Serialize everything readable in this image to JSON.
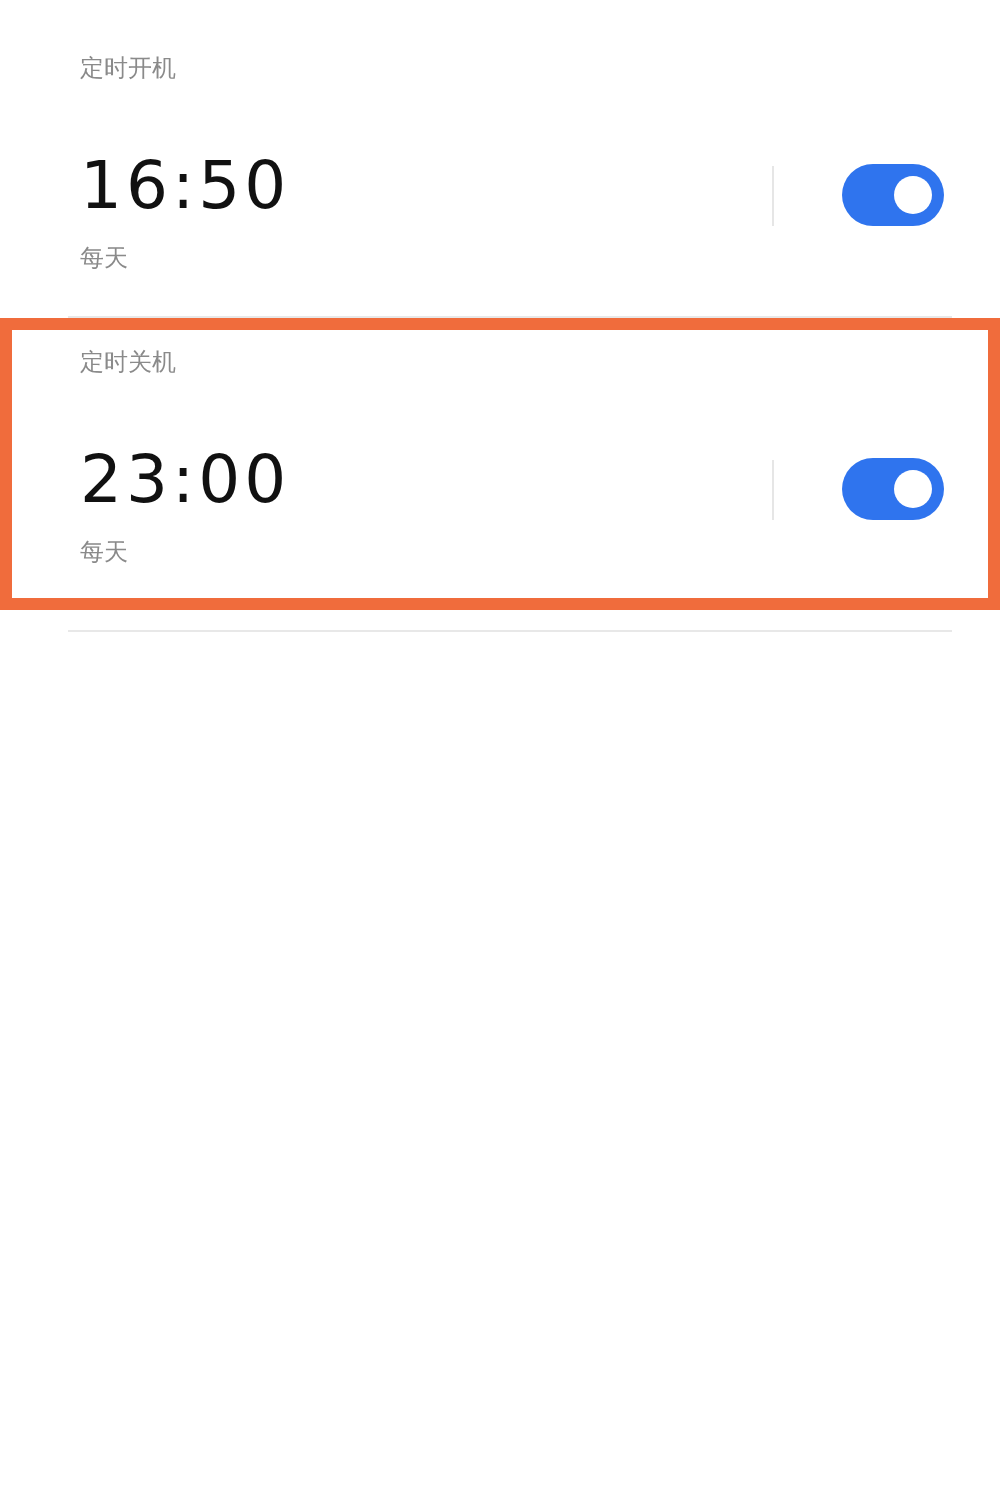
{
  "sections": [
    {
      "title": "定时开机",
      "time": "16:50",
      "repeat": "每天",
      "on": true,
      "highlighted": false
    },
    {
      "title": "定时关机",
      "time": "23:00",
      "repeat": "每天",
      "on": true,
      "highlighted": true
    }
  ]
}
